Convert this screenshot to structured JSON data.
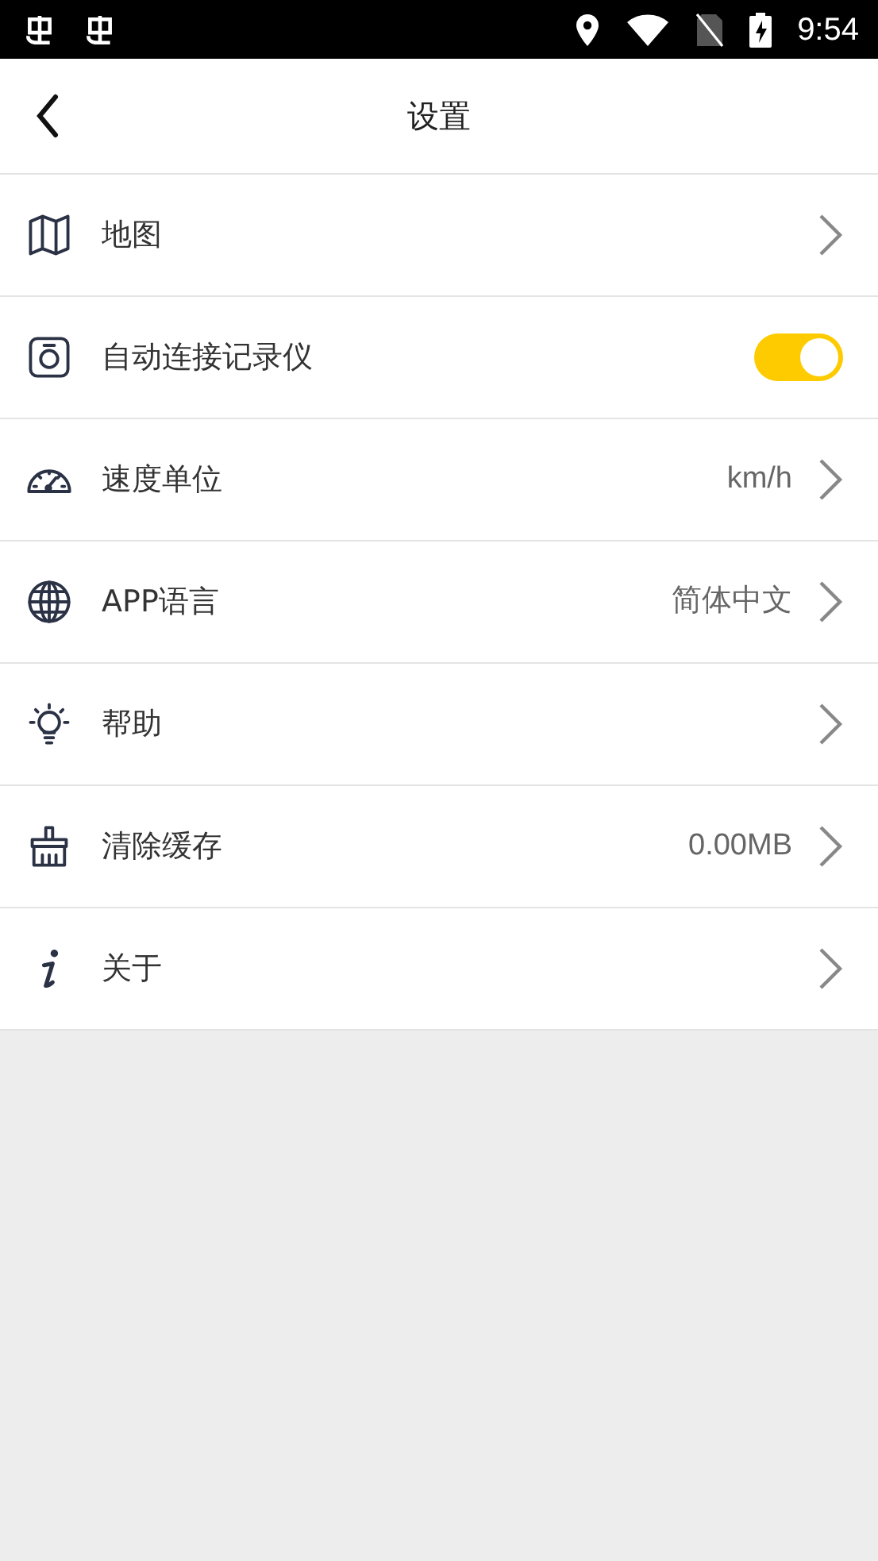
{
  "status_bar": {
    "time": "9:54"
  },
  "header": {
    "title": "设置"
  },
  "settings": [
    {
      "kind": "link",
      "label": "地图"
    },
    {
      "kind": "toggle",
      "label": "自动连接记录仪",
      "on": true
    },
    {
      "kind": "link",
      "label": "速度单位",
      "value": "km/h"
    },
    {
      "kind": "link",
      "label": "APP语言",
      "value": "简体中文"
    },
    {
      "kind": "link",
      "label": "帮助"
    },
    {
      "kind": "link",
      "label": "清除缓存",
      "value": "0.00MB"
    },
    {
      "kind": "link",
      "label": "关于"
    }
  ]
}
